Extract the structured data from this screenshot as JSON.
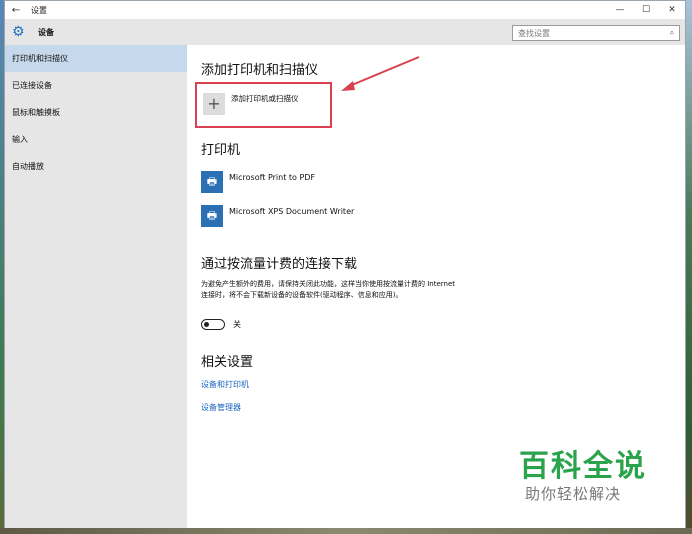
{
  "window": {
    "title": "设置",
    "back_glyph": "←",
    "minimize_glyph": "—",
    "maximize_glyph": "☐",
    "close_glyph": "✕"
  },
  "sidebar": {
    "header_label": "设备",
    "header_icon": "gear-icon",
    "items": [
      {
        "label": "打印机和扫描仪",
        "active": true
      },
      {
        "label": "已连接设备",
        "active": false
      },
      {
        "label": "鼠标和触摸板",
        "active": false
      },
      {
        "label": "输入",
        "active": false
      },
      {
        "label": "自动播放",
        "active": false
      }
    ]
  },
  "search": {
    "placeholder": "查找设置",
    "icon": "search-icon"
  },
  "main": {
    "add_section_title": "添加打印机和扫描仪",
    "add_button_label": "添加打印机或扫描仪",
    "printers_title": "打印机",
    "printers": [
      {
        "name": "Microsoft Print to PDF"
      },
      {
        "name": "Microsoft XPS Document Writer"
      }
    ],
    "metered_title": "通过按流量计费的连接下载",
    "metered_desc": "为避免产生额外的费用，请保持关闭此功能，这样当你使用按流量计费的 Internet 连接时，将不会下载新设备的设备软件(驱动程序、信息和应用)。",
    "toggle_label": "关",
    "toggle_on": false,
    "related_title": "相关设置",
    "links": [
      "设备和打印机",
      "设备管理器"
    ]
  },
  "watermark": {
    "title": "百科全说",
    "subtitle": "助你轻松解决"
  },
  "colors": {
    "accent": "#1a66c2",
    "highlight_box": "#d9414e",
    "sidebar_bg": "#e6e6e6",
    "sidebar_active": "#c6d9ec",
    "watermark_green": "#2aa34b"
  }
}
